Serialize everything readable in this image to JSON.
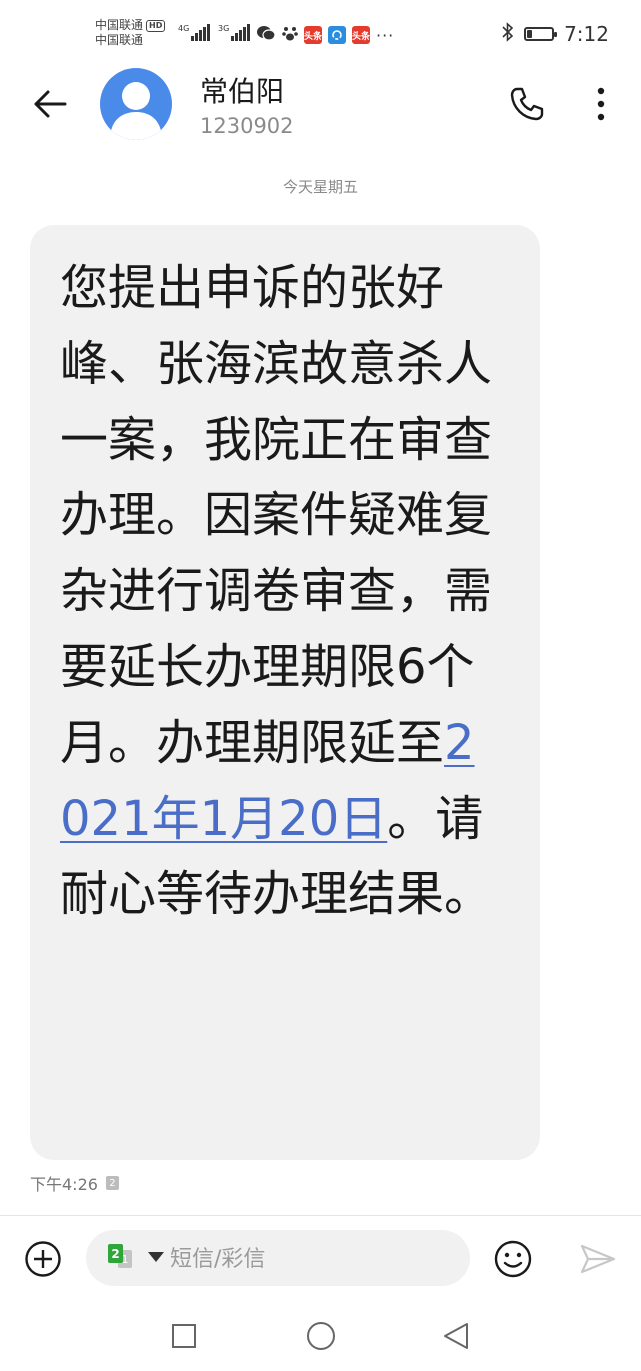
{
  "status_bar": {
    "carrier1": "中国联通",
    "carrier1_badge": "HD",
    "carrier2": "中国联通",
    "network1": "4G",
    "network2": "3G",
    "icons": [
      "wechat-icon",
      "baidu-paw-icon",
      "toutiao-icon",
      "sync-app-icon",
      "toutiao-icon"
    ],
    "app_badge_label": "头条",
    "more": "···",
    "time": "7:12",
    "battery_level": 0.2
  },
  "header": {
    "contact_name": "常伯阳",
    "contact_number": "1230902"
  },
  "conversation": {
    "date_label": "今天星期五",
    "message": {
      "text_before": "您提出申诉的张好峰、张海滨故意杀人一案，我院正在审查办理。因案件疑难复杂进行调卷审查，需要延长办理期限6个月。办理期限延至",
      "date_link": "2021年1月20日",
      "text_after": "。请耐心等待办理结果。",
      "time": "下午4:26",
      "sim_badge": "2"
    }
  },
  "compose": {
    "sim_primary": "2",
    "sim_secondary": "1",
    "placeholder": "短信/彩信"
  },
  "colors": {
    "accent_link": "#4a6ec8",
    "avatar_bg": "#4a8bea",
    "bubble_bg": "#f1f1f1",
    "sim_green": "#2fa53a"
  }
}
